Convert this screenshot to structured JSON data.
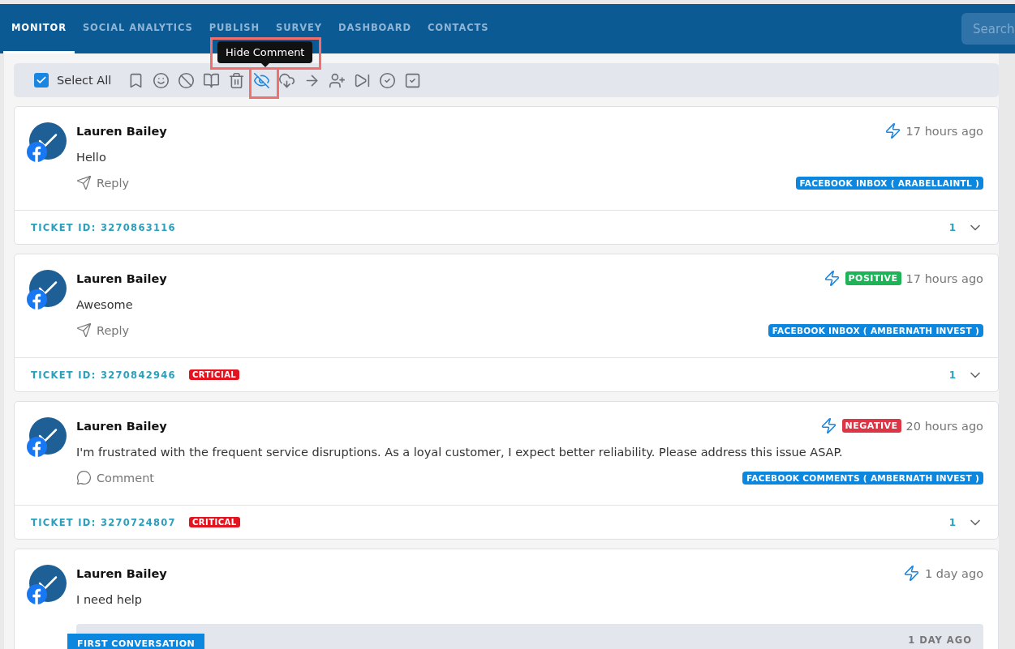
{
  "nav": {
    "tabs": [
      {
        "label": "MONITOR",
        "selected": true
      },
      {
        "label": "SOCIAL ANALYTICS",
        "selected": false
      },
      {
        "label": "PUBLISH",
        "selected": false
      },
      {
        "label": "SURVEY",
        "selected": false
      },
      {
        "label": "DASHBOARD",
        "selected": false
      },
      {
        "label": "CONTACTS",
        "selected": false
      }
    ],
    "search": {
      "placeholder": "Search"
    }
  },
  "toolbar": {
    "select_all": {
      "label": "Select All",
      "checked": true
    },
    "tools": [
      {
        "kind": "bookmark",
        "highlighted": false
      },
      {
        "kind": "smile",
        "highlighted": false
      },
      {
        "kind": "ban",
        "highlighted": false
      },
      {
        "kind": "book",
        "highlighted": false
      },
      {
        "kind": "trash",
        "highlighted": false
      },
      {
        "kind": "eye-off",
        "highlighted": true
      },
      {
        "kind": "cloud-download",
        "highlighted": false
      },
      {
        "kind": "arrow-right",
        "highlighted": false
      },
      {
        "kind": "user-plus",
        "highlighted": false
      },
      {
        "kind": "skip-forward",
        "highlighted": false
      },
      {
        "kind": "circle-check",
        "highlighted": false
      },
      {
        "kind": "square-check",
        "highlighted": false
      }
    ],
    "tooltip": "Hide Comment"
  },
  "cards": [
    {
      "author": "Lauren Bailey",
      "message": "Hello",
      "action": {
        "kind": "reply",
        "label": "Reply"
      },
      "time": "17 hours ago",
      "source": "FACEBOOK INBOX ( ARABELLAINTL )",
      "ticket": "TICKET ID: 3270863116",
      "count": "1"
    },
    {
      "author": "Lauren Bailey",
      "message": "Awesome",
      "action": {
        "kind": "reply",
        "label": "Reply"
      },
      "time": "17 hours ago",
      "sentiment": {
        "kind": "positive",
        "label": "POSITIVE"
      },
      "source": "FACEBOOK INBOX ( AMBERNATH INVEST )",
      "ticket": "TICKET ID: 3270842946",
      "priority": "CRTICIAL",
      "count": "1"
    },
    {
      "author": "Lauren Bailey",
      "message": "I'm frustrated with the frequent service disruptions. As a loyal customer, I expect better reliability. Please address this issue ASAP.",
      "action": {
        "kind": "comment",
        "label": "Comment"
      },
      "time": "20 hours ago",
      "sentiment": {
        "kind": "negative",
        "label": "NEGATIVE"
      },
      "source": "FACEBOOK COMMENTS ( AMBERNATH INVEST )",
      "ticket": "TICKET ID: 3270724807",
      "priority": "CRITICAL",
      "count": "1"
    },
    {
      "author": "Lauren Bailey",
      "message": "I need help",
      "time": "1 day ago",
      "conversation": {
        "badge": "FIRST CONVERSATION",
        "time": "1 DAY AGO"
      }
    }
  ]
}
